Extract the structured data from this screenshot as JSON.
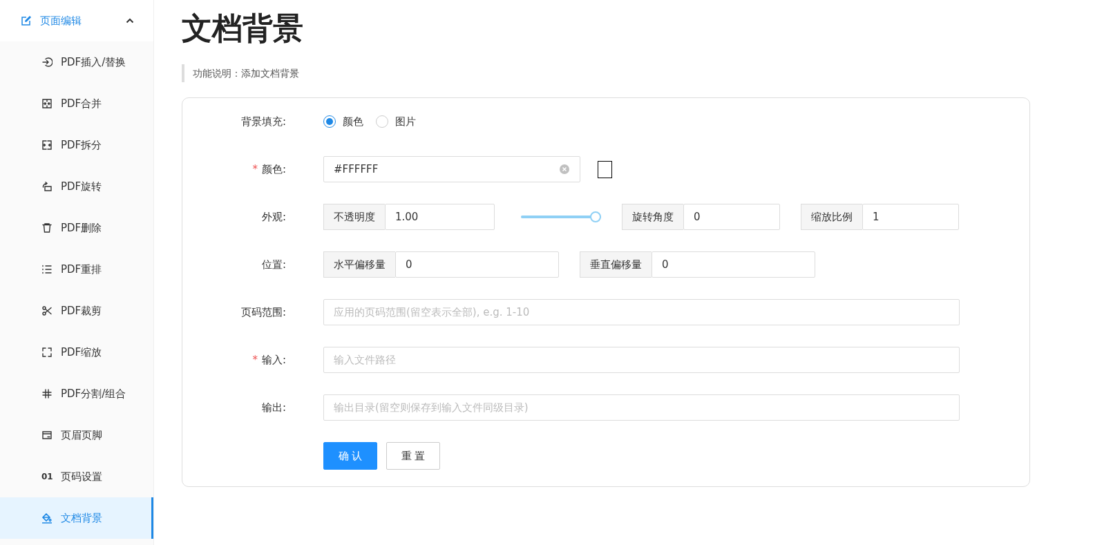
{
  "sidebar": {
    "group": {
      "label": "页面编辑",
      "expanded": true
    },
    "items": [
      {
        "label": "PDF插入/替换",
        "selected": false
      },
      {
        "label": "PDF合并",
        "selected": false
      },
      {
        "label": "PDF拆分",
        "selected": false
      },
      {
        "label": "PDF旋转",
        "selected": false
      },
      {
        "label": "PDF删除",
        "selected": false
      },
      {
        "label": "PDF重排",
        "selected": false
      },
      {
        "label": "PDF裁剪",
        "selected": false
      },
      {
        "label": "PDF缩放",
        "selected": false
      },
      {
        "label": "PDF分割/组合",
        "selected": false
      },
      {
        "label": "页眉页脚",
        "selected": false
      },
      {
        "label": "页码设置",
        "icon_text": "01",
        "selected": false
      },
      {
        "label": "文档背景",
        "selected": true
      }
    ]
  },
  "page": {
    "title": "文档背景",
    "description": "功能说明：添加文档背景"
  },
  "form": {
    "rows": [
      {
        "kind": "radio",
        "label": "背景填充:",
        "options": [
          {
            "label": "颜色",
            "selected": true
          },
          {
            "label": "图片",
            "selected": false
          }
        ]
      },
      {
        "kind": "color",
        "label": "颜色:",
        "required_mark": "*",
        "value": "#FFFFFF"
      },
      {
        "kind": "appearance",
        "label": "外观:",
        "opacity": {
          "addon": "不透明度",
          "value": "1.00"
        },
        "slider": {
          "level": 1
        },
        "groups": [
          {
            "addon": "旋转角度",
            "value": "0"
          },
          {
            "addon": "缩放比例",
            "value": "1"
          }
        ]
      },
      {
        "kind": "groups",
        "label": "位置:",
        "groups": [
          {
            "addon": "水平偏移量",
            "value": "0"
          },
          {
            "addon": "垂直偏移量",
            "value": "0"
          }
        ]
      },
      {
        "kind": "text",
        "label": "页码范围:",
        "placeholder": "应用的页码范围(留空表示全部), e.g. 1-10"
      },
      {
        "kind": "text",
        "label": "输入:",
        "required_mark": "*",
        "placeholder": "输入文件路径"
      },
      {
        "kind": "text",
        "label": "输出:",
        "placeholder": "输出目录(留空则保存到输入文件同级目录)"
      }
    ],
    "buttons": [
      {
        "label": "确 认",
        "kind": "primary"
      },
      {
        "label": "重 置",
        "kind": "default"
      }
    ]
  }
}
